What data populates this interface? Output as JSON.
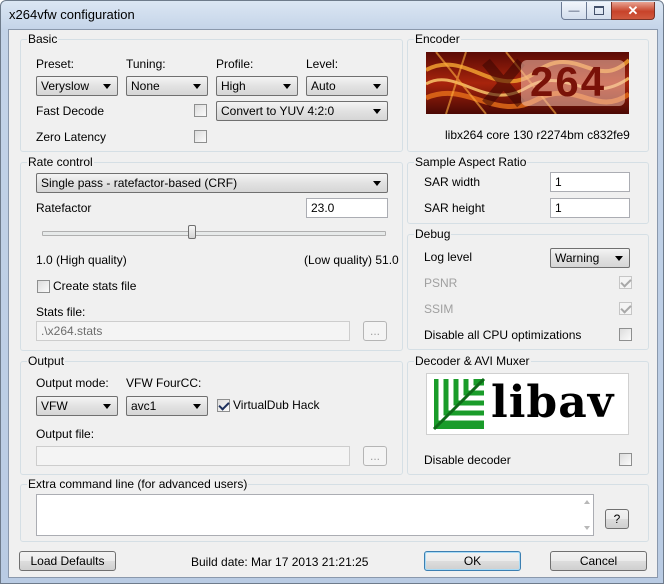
{
  "window": {
    "title": "x264vfw configuration"
  },
  "basic": {
    "group_title": "Basic",
    "preset": {
      "label": "Preset:",
      "value": "Veryslow"
    },
    "tuning": {
      "label": "Tuning:",
      "value": "None"
    },
    "profile": {
      "label": "Profile:",
      "value": "High"
    },
    "level": {
      "label": "Level:",
      "value": "Auto"
    },
    "fast_decode": {
      "label": "Fast Decode",
      "checked": false
    },
    "colorspace": {
      "value": "Convert to YUV 4:2:0"
    },
    "zero_latency": {
      "label": "Zero Latency",
      "checked": false
    }
  },
  "encoder": {
    "group_title": "Encoder",
    "logo_text": "264",
    "version": "libx264 core 130 r2274bm c832fe9"
  },
  "rate_control": {
    "group_title": "Rate control",
    "mode": "Single pass - ratefactor-based (CRF)",
    "ratefactor_label": "Ratefactor",
    "ratefactor_value": "23.0",
    "slider_fraction": 0.44,
    "min_label": "1.0 (High quality)",
    "max_label": "(Low quality) 51.0",
    "create_stats": {
      "label": "Create stats file",
      "checked": false
    },
    "stats_file_label": "Stats file:",
    "stats_file_value": ".\\x264.stats",
    "browse_label": "..."
  },
  "sar": {
    "group_title": "Sample Aspect Ratio",
    "width_label": "SAR width",
    "width_value": "1",
    "height_label": "SAR height",
    "height_value": "1"
  },
  "debug": {
    "group_title": "Debug",
    "log_level_label": "Log level",
    "log_level_value": "Warning",
    "psnr": {
      "label": "PSNR",
      "checked": true
    },
    "ssim": {
      "label": "SSIM",
      "checked": true
    },
    "disable_cpu": {
      "label": "Disable all CPU optimizations",
      "checked": false
    }
  },
  "output": {
    "group_title": "Output",
    "mode_label": "Output mode:",
    "mode_value": "VFW",
    "fourcc_label": "VFW FourCC:",
    "fourcc_value": "avc1",
    "vdub_hack": {
      "label": "VirtualDub Hack",
      "checked": true
    },
    "file_label": "Output file:",
    "file_value": "",
    "browse_label": "..."
  },
  "decoder": {
    "group_title": "Decoder & AVI Muxer",
    "logo_text": "libav",
    "disable_decoder": {
      "label": "Disable decoder",
      "checked": false
    }
  },
  "extra": {
    "group_title": "Extra command line (for advanced users)",
    "value": "",
    "help_label": "?"
  },
  "footer": {
    "load_defaults_label": "Load Defaults",
    "build_date": "Build date: Mar 17 2013 21:21:25",
    "ok_label": "OK",
    "cancel_label": "Cancel"
  },
  "colors": {
    "client_bg": "#f0f0f0",
    "title_bar": "#c3d3e8",
    "close_button": "#c7432a",
    "libav_green": "#1a9c2a",
    "x264_orange": "#e8701a"
  }
}
